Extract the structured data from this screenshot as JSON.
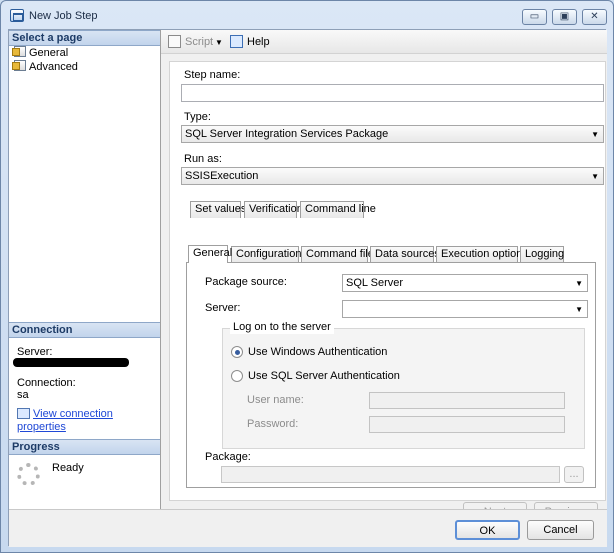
{
  "window": {
    "title": "New Job Step",
    "minimize_symbol": "▭",
    "restore_symbol": "▣",
    "close_symbol": "✕"
  },
  "sidebar": {
    "select_page_header": "Select a page",
    "pages": [
      {
        "label": "General",
        "icon": "page-settings-icon"
      },
      {
        "label": "Advanced",
        "icon": "page-settings-icon"
      }
    ],
    "connection_header": "Connection",
    "server_label": "Server:",
    "connection_label": "Connection:",
    "connection_value": "sa",
    "view_properties_link": "View connection properties",
    "progress_header": "Progress",
    "progress_status": "Ready"
  },
  "toolbar": {
    "script_label": "Script",
    "script_dropdown_symbol": "▼",
    "help_label": "Help"
  },
  "form": {
    "step_name_label": "Step name:",
    "step_name_value": "",
    "type_label": "Type:",
    "type_value": "SQL Server Integration Services Package",
    "run_as_label": "Run as:",
    "run_as_value": "SSISExecution"
  },
  "tabs": {
    "top_row": [
      "Set values",
      "Verification",
      "Command line"
    ],
    "bottom_row": [
      "General",
      "Configurations",
      "Command files",
      "Data sources",
      "Execution options",
      "Logging"
    ],
    "active": "General"
  },
  "general_tab": {
    "package_source_label": "Package source:",
    "package_source_value": "SQL Server",
    "server_label": "Server:",
    "server_value": "",
    "logon_group_title": "Log on to the server",
    "windows_auth_label": "Use Windows Authentication",
    "sql_auth_label": "Use SQL Server Authentication",
    "selected_auth": "windows",
    "user_name_label": "User name:",
    "password_label": "Password:",
    "package_label": "Package:",
    "package_value": "",
    "browse_button_label": "..."
  },
  "navigation": {
    "next_label": "Next",
    "previous_label": "Previous"
  },
  "footer": {
    "ok_label": "OK",
    "cancel_label": "Cancel"
  }
}
